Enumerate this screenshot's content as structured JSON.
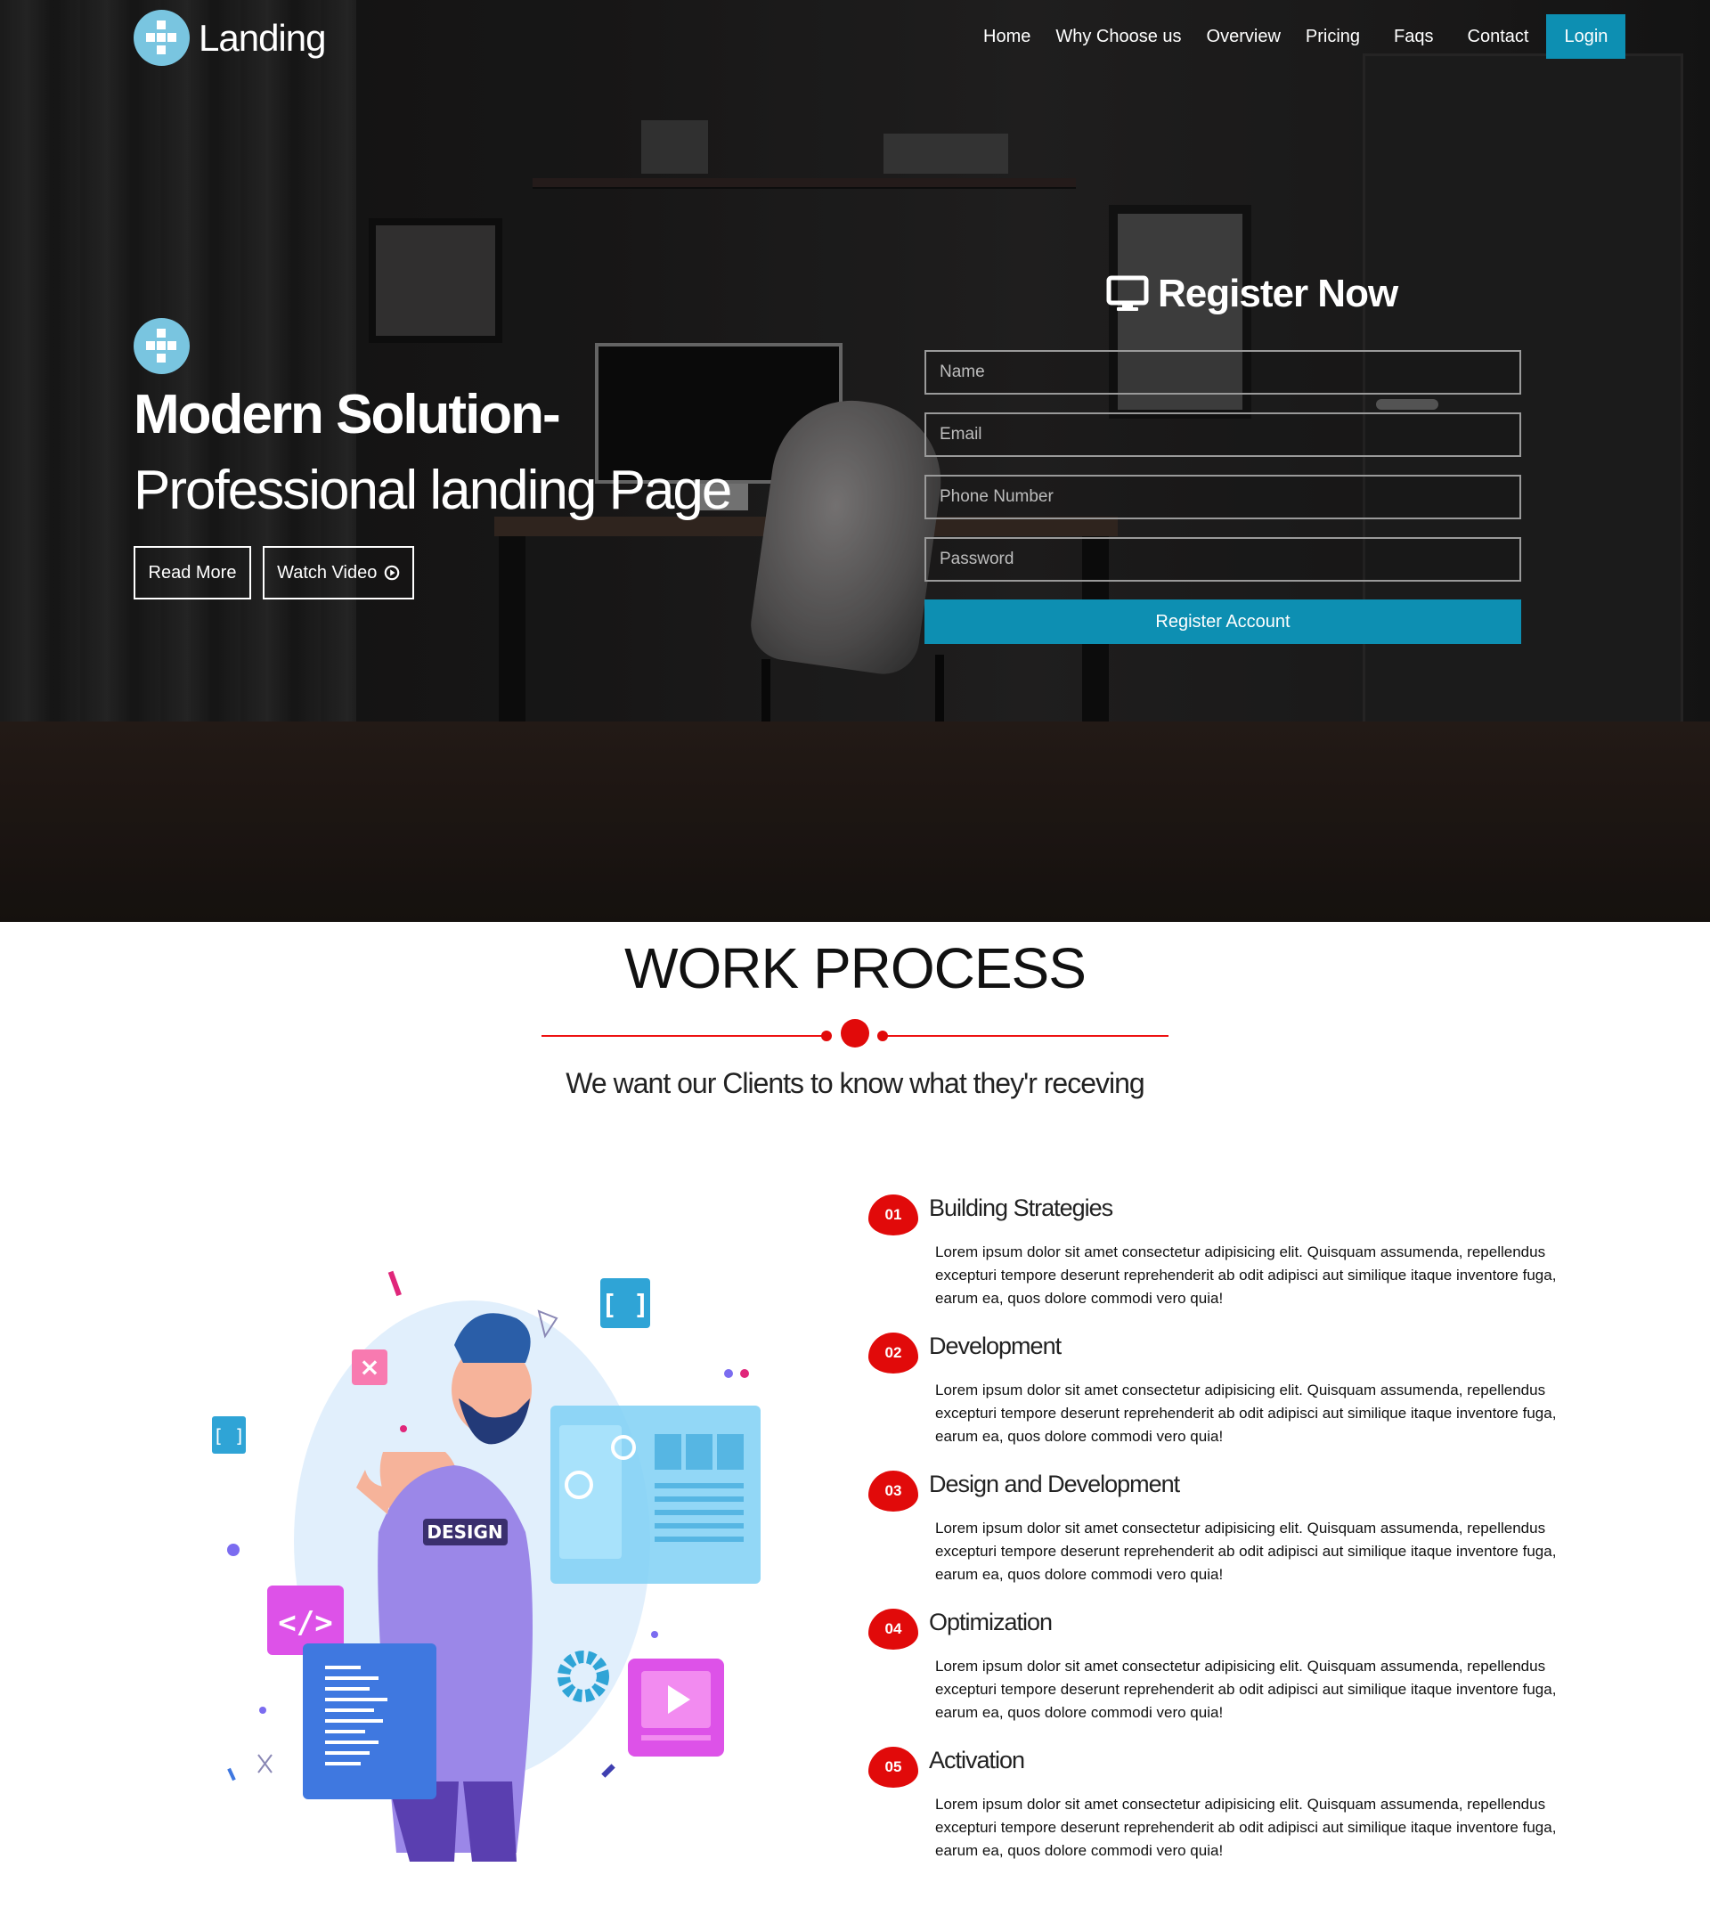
{
  "brand": {
    "name": "Landing"
  },
  "nav": {
    "items": [
      "Home",
      "Why Choose us",
      "Overview",
      "Pricing",
      "Faqs",
      "Contact"
    ],
    "login": "Login"
  },
  "hero": {
    "title": "Modern Solution-",
    "subtitle": "Professional landing Page",
    "read_more": "Read More",
    "watch_video": "Watch Video"
  },
  "register": {
    "title": "Register Now",
    "name_placeholder": "Name",
    "email_placeholder": "Email",
    "phone_placeholder": "Phone Number",
    "password_placeholder": "Password",
    "submit": "Register Account"
  },
  "work_process": {
    "title": "WORK PROCESS",
    "subtitle": "We want our Clients to know what they'r receving",
    "illustration_label": "DESIGN",
    "steps": [
      {
        "num": "01",
        "title": "Building Strategies",
        "text": "Lorem ipsum dolor sit amet consectetur adipisicing elit. Quisquam assumenda, repellendus excepturi tempore deserunt reprehenderit ab odit adipisci aut similique itaque inventore fuga, earum ea, quos dolore commodi vero quia!"
      },
      {
        "num": "02",
        "title": "Development",
        "text": "Lorem ipsum dolor sit amet consectetur adipisicing elit. Quisquam assumenda, repellendus excepturi tempore deserunt reprehenderit ab odit adipisci aut similique itaque inventore fuga, earum ea, quos dolore commodi vero quia!"
      },
      {
        "num": "03",
        "title": "Design and Development",
        "text": "Lorem ipsum dolor sit amet consectetur adipisicing elit. Quisquam assumenda, repellendus excepturi tempore deserunt reprehenderit ab odit adipisci aut similique itaque inventore fuga, earum ea, quos dolore commodi vero quia!"
      },
      {
        "num": "04",
        "title": "Optimization",
        "text": "Lorem ipsum dolor sit amet consectetur adipisicing elit. Quisquam assumenda, repellendus excepturi tempore deserunt reprehenderit ab odit adipisci aut similique itaque inventore fuga, earum ea, quos dolore commodi vero quia!"
      },
      {
        "num": "05",
        "title": "Activation",
        "text": "Lorem ipsum dolor sit amet consectetur adipisicing elit. Quisquam assumenda, repellendus excepturi tempore deserunt reprehenderit ab odit adipisci aut similique itaque inventore fuga, earum ea, quos dolore commodi vero quia!"
      }
    ]
  },
  "colors": {
    "accent": "#0d8fb2",
    "red": "#e10a0a",
    "logo": "#79c5e0"
  },
  "icons": {
    "logo": "grid-cross-icon",
    "register": "monitor-icon",
    "video": "play-circle-icon"
  }
}
